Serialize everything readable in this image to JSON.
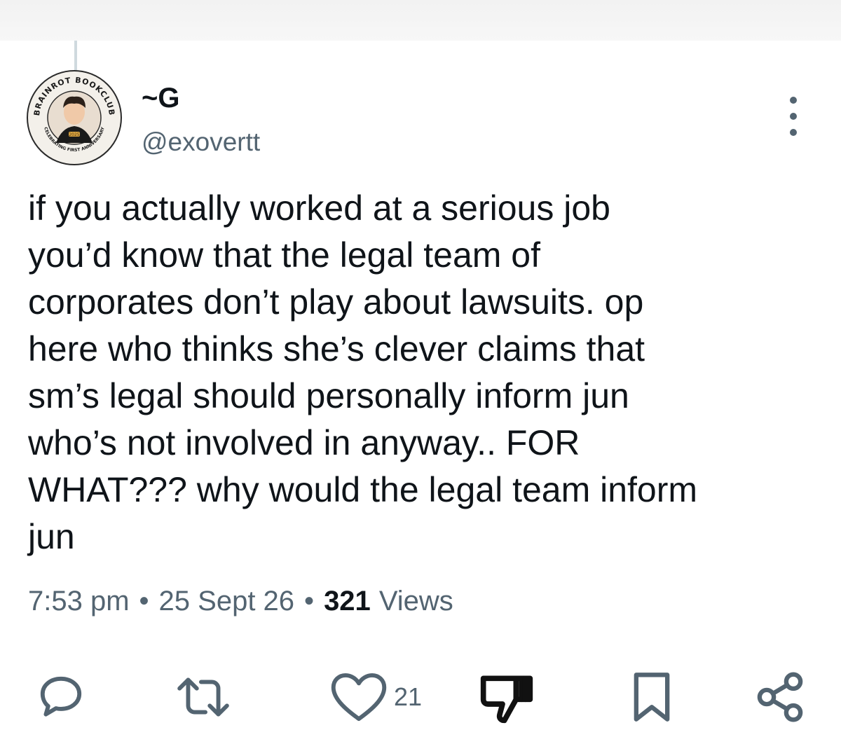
{
  "author": {
    "display_name": "~G",
    "handle": "@exovertt",
    "avatar_badge_top": "BRAINROT BOOKCLUB",
    "avatar_badge_bottom": "CELEBRATING FIRST ANNIVERSARY",
    "avatar_badge_year": "2025"
  },
  "tweet": {
    "text": "if you actually worked at a serious job\nyou’d know that the legal team of\ncorporates don’t play about lawsuits. op\nhere who thinks she’s clever claims that\nsm’s legal should personally inform jun\nwho’s not involved in anyway.. FOR\nWHAT??? why would the legal team inform\njun",
    "time": "7:53 pm",
    "date": "25 Sept 26",
    "separator": "•",
    "views_count": "321",
    "views_label": "Views"
  },
  "actions": {
    "reply_icon": "speech-bubble-icon",
    "repost_icon": "repost-arrows-icon",
    "like_icon": "heart-icon",
    "like_count": "21",
    "dislike_icon": "thumbs-down-icon",
    "bookmark_icon": "bookmark-icon",
    "share_icon": "share-nodes-icon"
  },
  "colors": {
    "text_primary": "#0f1419",
    "text_secondary": "#536471",
    "divider": "#cfd9de"
  }
}
